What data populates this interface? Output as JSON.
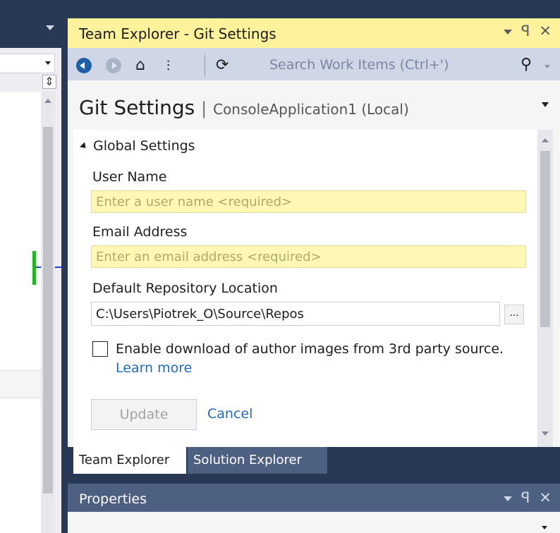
{
  "team_explorer": {
    "window_title": "Team Explorer - Git Settings",
    "title_controls": {
      "pin": "ꟼ",
      "close": "✕"
    },
    "toolbar": {
      "icons": [
        "back-icon",
        "forward-icon",
        "home-icon",
        "connect-icon",
        "refresh-icon"
      ],
      "search_placeholder": "Search Work Items (Ctrl+')",
      "search_icon_glyph": "⚲"
    },
    "page": {
      "title": "Git Settings",
      "separator": "|",
      "subtitle": "ConsoleApplication1 (Local)"
    },
    "global_settings": {
      "header": "Global Settings",
      "user_name_label": "User Name",
      "user_name_placeholder": "Enter a user name <required>",
      "email_label": "Email Address",
      "email_placeholder": "Enter an email address <required>",
      "repo_location_label": "Default Repository Location",
      "repo_location_value": "C:\\Users\\Piotrek_O\\Source\\Repos",
      "browse_label": "...",
      "author_images_text": "Enable download of author images from 3rd party source.",
      "learn_more": "Learn more",
      "update_label": "Update",
      "cancel_label": "Cancel"
    },
    "tabs": [
      "Team Explorer",
      "Solution Explorer"
    ]
  },
  "properties": {
    "title": "Properties"
  },
  "colors": {
    "active_title_bg": "#fff29d",
    "toolbar_bg": "#cfd6e5",
    "required_input_bg": "#fff8b5",
    "link": "#1e6cc0",
    "ide_frame": "#293955"
  }
}
